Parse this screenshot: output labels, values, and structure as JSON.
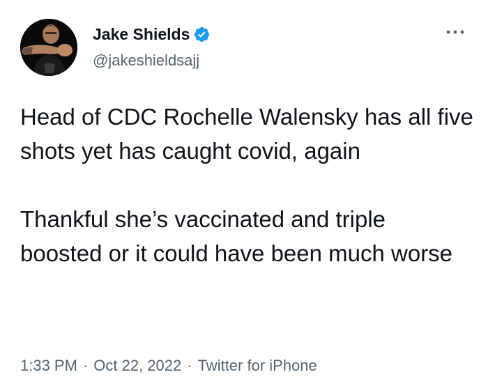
{
  "author": {
    "display_name": "Jake Shields",
    "handle": "@jakeshieldsajj",
    "verified": true
  },
  "tweet": {
    "paragraphs": [
      "Head of CDC Rochelle Walensky has all five shots yet has caught covid, again",
      "Thankful she’s vaccinated and triple boosted or it could have been much worse"
    ],
    "time": "1:33 PM",
    "date": "Oct 22, 2022",
    "source": "Twitter for iPhone",
    "separator": "·"
  },
  "icons": {
    "verified": "verified-badge-icon",
    "more": "more-options-icon"
  },
  "colors": {
    "text_primary": "#0f1419",
    "text_secondary": "#536471",
    "verified_blue": "#1d9bf0",
    "background": "#ffffff"
  }
}
